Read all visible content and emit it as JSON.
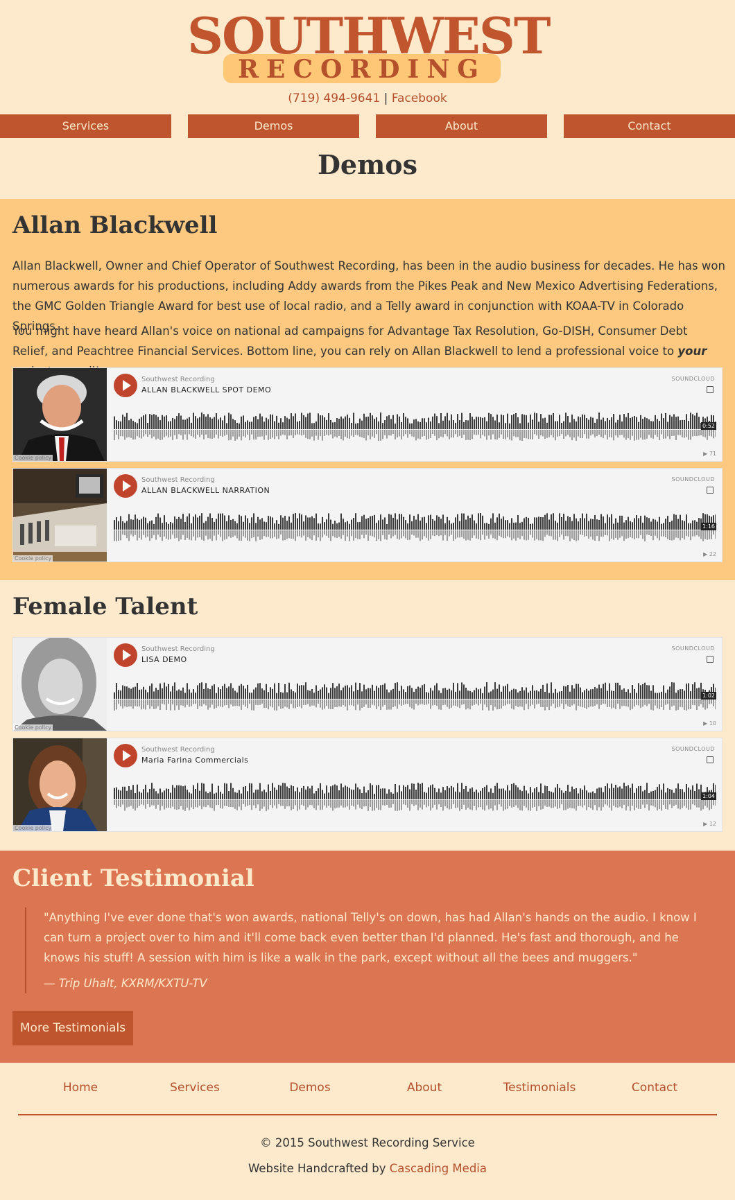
{
  "logo": {
    "main": "SOUTHWEST",
    "sub": "RECORDING"
  },
  "contact": {
    "phone": "(719) 494-9641",
    "separator": "|",
    "facebook": "Facebook"
  },
  "nav": [
    "Services",
    "Demos",
    "About",
    "Contact"
  ],
  "page_title": "Demos",
  "allan": {
    "heading": "Allan Blackwell",
    "para1": "Allan Blackwell, Owner and Chief Operator of Southwest Recording, has been in the audio business for decades. He has won numerous awards for his productions, including Addy awards from the Pikes Peak and New Mexico Advertising Federations, the GMC Golden Triangle Award for best use of local radio, and a Telly award in conjunction with KOAA-TV in Colorado Springs.",
    "para2_before": "You might have heard Allan's voice on national ad campaigns for Advantage Tax Resolution, Go-DISH, Consumer Debt Relief, and Peachtree Financial Services. Bottom line, you can rely on Allan Blackwell to lend a professional voice to ",
    "para2_emph": "your",
    "para2_after": " project as well!"
  },
  "female": {
    "heading": "Female Talent"
  },
  "player_common": {
    "artist": "Southwest Recording",
    "brand": "SOUNDCLOUD",
    "cookie": "Cookie policy"
  },
  "players": [
    {
      "title": "ALLAN BLACKWELL SPOT DEMO",
      "duration": "0:52",
      "plays": "71"
    },
    {
      "title": "ALLAN BLACKWELL NARRATION",
      "duration": "1:16",
      "plays": "22"
    },
    {
      "title": "LISA DEMO",
      "duration": "1:02",
      "plays": "10"
    },
    {
      "title": "Maria Farina Commercials",
      "duration": "1:04",
      "plays": "12"
    }
  ],
  "testimonial": {
    "heading": "Client Testimonial",
    "quote": "\"Anything I've ever done that's won awards, national Telly's on down, has had Allan's hands on the audio. I know I can turn a project over to him and it'll come back even better than I'd planned. He's fast and thorough, and he knows his stuff! A session with him is like a walk in the park, except without all the bees and muggers.\"",
    "cite": "— Trip Uhalt, KXRM/KXTU-TV",
    "more_button": "More Testimonials"
  },
  "footer": {
    "nav": [
      "Home",
      "Services",
      "Demos",
      "About",
      "Testimonials",
      "Contact"
    ],
    "copyright": "© 2015 Southwest Recording Service",
    "credit_prefix": "Website Handcrafted by ",
    "credit_link": "Cascading Media"
  },
  "colors": {
    "primary": "#bf552e",
    "background": "#fde9cc",
    "band": "#fdc981",
    "testimonial": "#dc7551"
  }
}
